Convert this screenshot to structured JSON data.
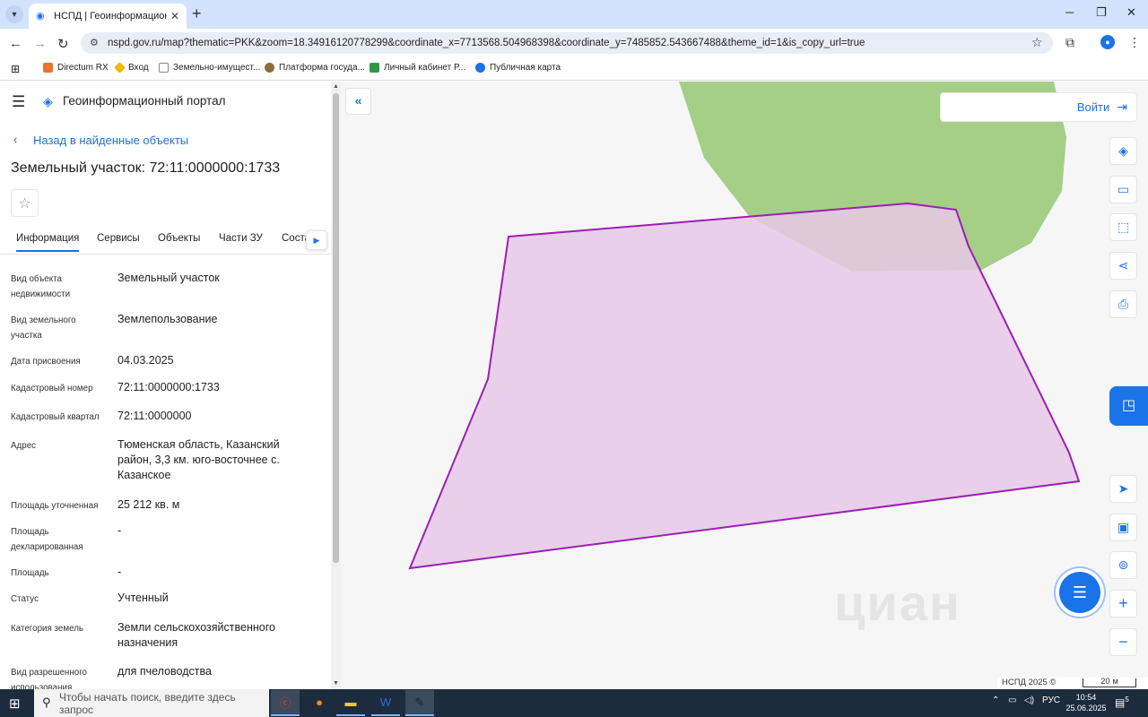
{
  "browser": {
    "tab_title": "НСПД | Геоинформационный",
    "url": "nspd.gov.ru/map?thematic=PKK&zoom=18.34916120778299&coordinate_x=7713568.504968398&coordinate_y=7485852.543667488&theme_id=1&is_copy_url=true",
    "bookmarks": [
      "Directum RX",
      "Вход",
      "Земельно-имущест...",
      "Платформа госуда...",
      "Личный кабинет Р...",
      "Публичная карта"
    ]
  },
  "sidebar": {
    "portal_title": "Геоинформационный портал",
    "back_label": "Назад в найденные объекты",
    "page_title": "Земельный участок: 72:11:0000000:1733",
    "tabs": [
      "Информация",
      "Сервисы",
      "Объекты",
      "Части ЗУ",
      "Состав"
    ],
    "properties": [
      {
        "label": "Вид объекта недвижимости",
        "value": "Земельный участок"
      },
      {
        "label": "Вид земельного участка",
        "value": "Землепользование"
      },
      {
        "label": "Дата присвоения",
        "value": "04.03.2025"
      },
      {
        "label": "Кадастровый номер",
        "value": "72:11:0000000:1733"
      },
      {
        "label": "Кадастровый квартал",
        "value": "72:11:0000000"
      },
      {
        "label": "Адрес",
        "value": "Тюменская область, Казанский район, 3,3 км. юго-восточнее с. Казанское"
      },
      {
        "label": "Площадь уточненная",
        "value": "25 212 кв. м"
      },
      {
        "label": "Площадь декларированная",
        "value": "-"
      },
      {
        "label": "Площадь",
        "value": "-"
      },
      {
        "label": "Статус",
        "value": "Учтенный"
      },
      {
        "label": "Категория земель",
        "value": "Земли сельскохозяйственного назначения"
      },
      {
        "label": "Вид разрешенного использования",
        "value": "для пчеловодства"
      }
    ]
  },
  "map": {
    "login_label": "Войти",
    "attribution": "НСПД 2025 ©",
    "scale_label": "20 м",
    "watermark": "циан",
    "parcel_fill": "#e6c8e6",
    "parcel_stroke": "#9b1fb5",
    "green_fill": "#a5cf86"
  },
  "taskbar": {
    "search_placeholder": "Чтобы начать поиск, введите здесь запрос",
    "lang": "РУС",
    "time": "10:54",
    "date": "25.06.2025",
    "notifications": "5"
  }
}
